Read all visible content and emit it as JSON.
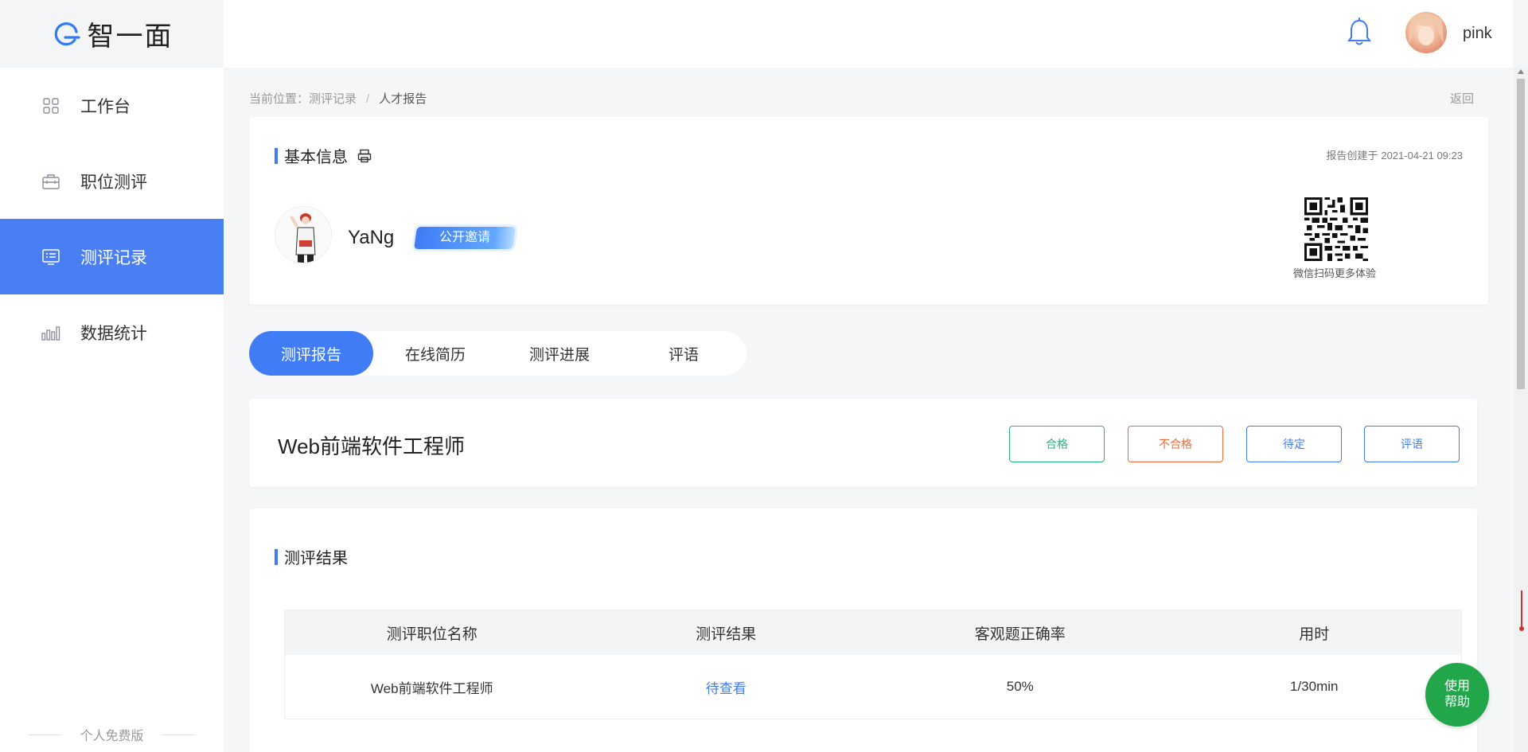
{
  "app": {
    "logo_text": "智一面"
  },
  "sidebar": {
    "items": [
      {
        "label": "工作台",
        "icon": "grid-icon"
      },
      {
        "label": "职位测评",
        "icon": "briefcase-icon"
      },
      {
        "label": "测评记录",
        "icon": "document-icon"
      },
      {
        "label": "数据统计",
        "icon": "bar-chart-icon"
      }
    ],
    "active_index": 2,
    "footer": "个人免费版"
  },
  "header": {
    "username": "pink"
  },
  "breadcrumb": {
    "prefix": "当前位置：",
    "items": [
      "测评记录",
      "人才报告"
    ],
    "separator": "/",
    "back": "返回"
  },
  "basic_info": {
    "title": "基本信息",
    "created_label": "报告创建于",
    "created_at": "2021-04-21 09:23",
    "candidate_name": "YaNg",
    "invite_type": "公开邀请",
    "qr_caption": "微信扫码更多体验"
  },
  "tabs": [
    {
      "label": "测评报告"
    },
    {
      "label": "在线简历"
    },
    {
      "label": "测评进展"
    },
    {
      "label": "评语"
    }
  ],
  "position": {
    "title": "Web前端软件工程师",
    "buttons": {
      "pass": "合格",
      "fail": "不合格",
      "pending": "待定",
      "comment": "评语"
    }
  },
  "results": {
    "title": "测评结果",
    "columns": [
      "测评职位名称",
      "测评结果",
      "客观题正确率",
      "用时"
    ],
    "rows": [
      {
        "position": "Web前端软件工程师",
        "result": "待查看",
        "accuracy": "50%",
        "time": "1/30min"
      }
    ]
  },
  "help": {
    "line1": "使用",
    "line2": "帮助"
  },
  "colors": {
    "accent": "#3f7cf5",
    "pass": "#23b57a",
    "fail": "#f06a3a",
    "help": "#21a74a"
  }
}
